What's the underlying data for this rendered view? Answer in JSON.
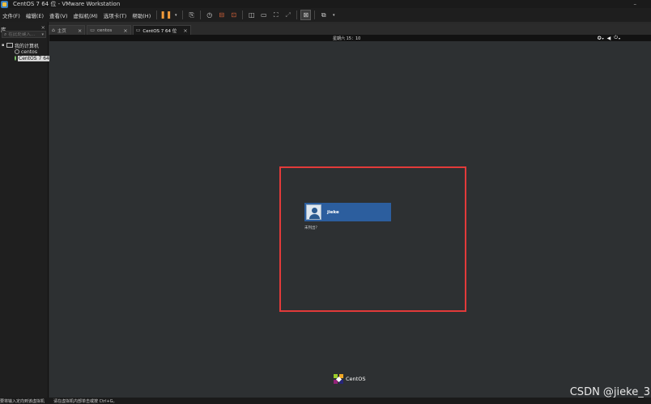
{
  "window": {
    "title": "CentOS 7 64 位 - VMware Workstation",
    "controls": "–"
  },
  "menu": [
    "文件(F)",
    "编辑(E)",
    "查看(V)",
    "虚拟机(M)",
    "选项卡(T)",
    "帮助(H)"
  ],
  "sidebar": {
    "title": "库",
    "close": "×",
    "search_placeholder": "在此处键入...",
    "root": "我的计算机",
    "items": [
      {
        "label": "centos"
      },
      {
        "label": "CentOS 7 64"
      }
    ]
  },
  "tabs": [
    {
      "label": "主页",
      "icon": "home-icon",
      "close": "×"
    },
    {
      "label": "centos",
      "icon": "vm-icon",
      "close": "×"
    },
    {
      "label": "CentOS 7 64 位",
      "icon": "vm-icon",
      "close": "×",
      "active": true
    }
  ],
  "vm": {
    "clock": "星期六 15：10",
    "status_icons": [
      "accessibility-icon",
      "volume-icon",
      "power-icon"
    ],
    "user": {
      "name": "jieke"
    },
    "not_listed": "未列出？",
    "brand": "CentOS"
  },
  "statusbar": {
    "left": "要将输入定向到该虚拟机",
    "right": "请在虚拟机内部单击或按 Ctrl+G。"
  },
  "watermark": "CSDN @jieke_3",
  "colors": {
    "highlight": "#e23a3a",
    "user_card": "#2c5e9e",
    "pause": "#f29b3a"
  }
}
